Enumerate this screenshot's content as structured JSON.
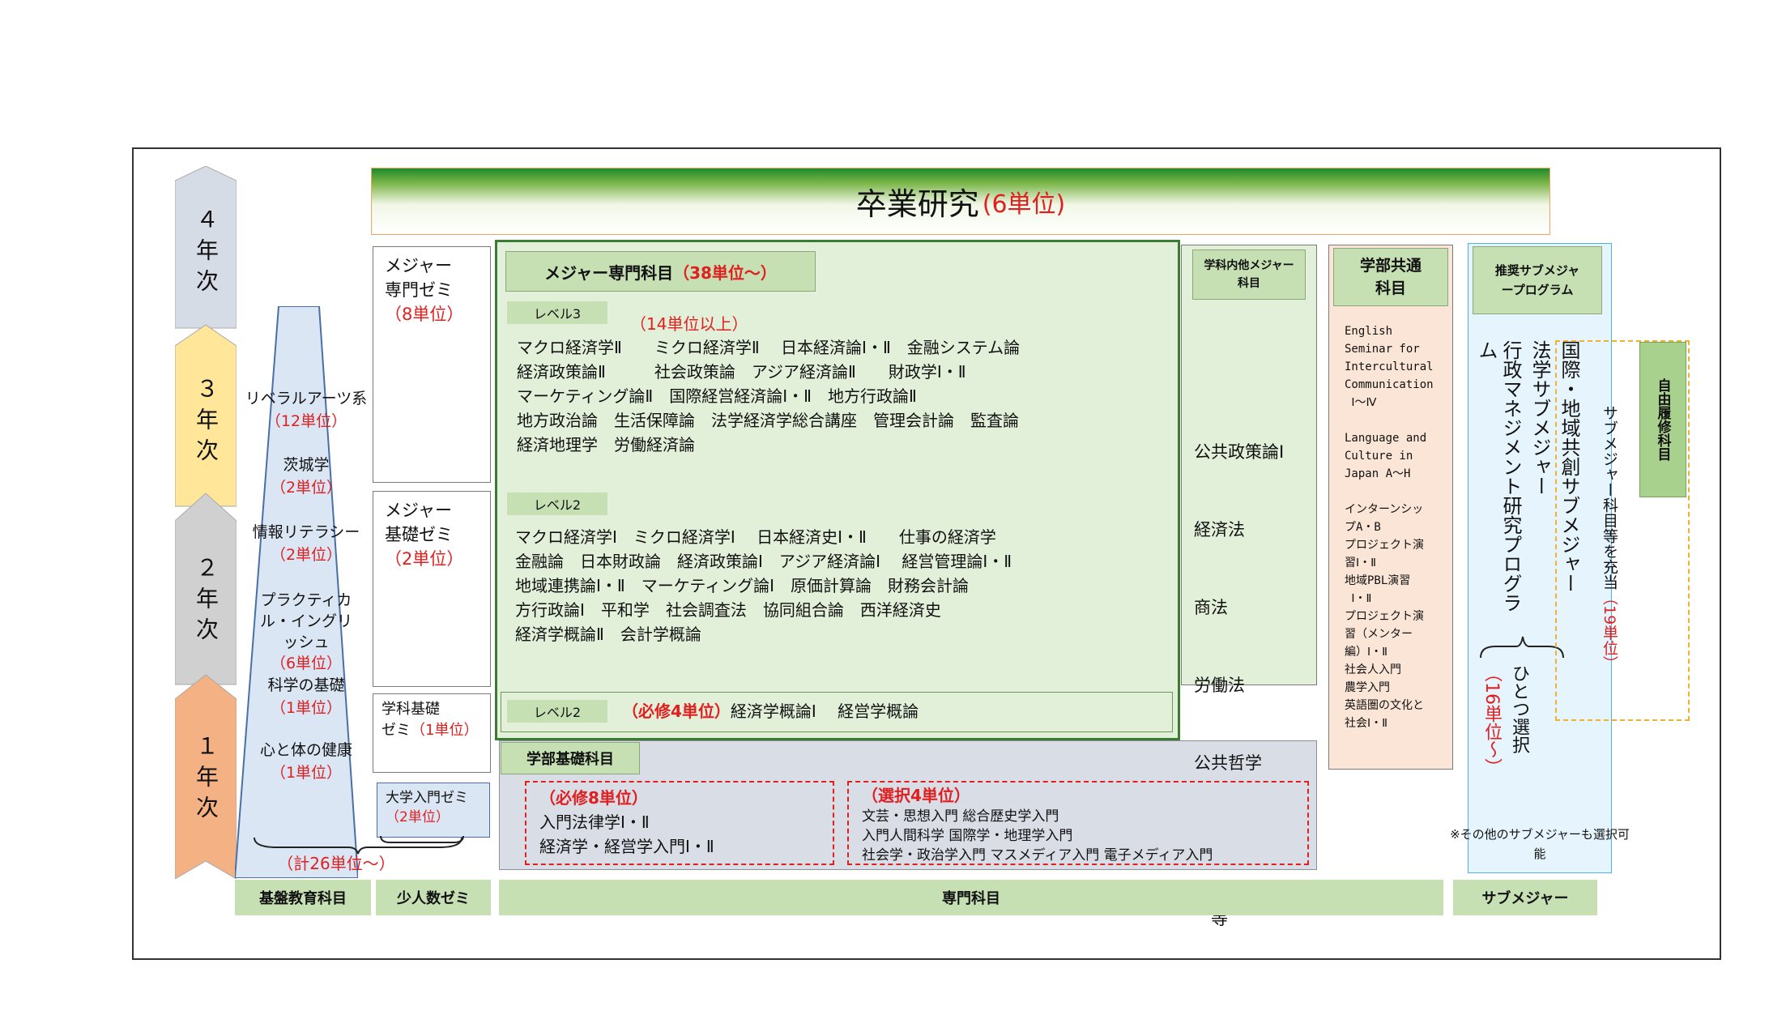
{
  "years": [
    {
      "label": "４年次",
      "color": "#d6dce5"
    },
    {
      "label": "３年次",
      "color": "#ffe699"
    },
    {
      "label": "２年次",
      "color": "#d0d0d0"
    },
    {
      "label": "１年次",
      "color": "#f4b183"
    }
  ],
  "graduation": {
    "title": "卒業研究",
    "units": "(6単位)"
  },
  "liberal": {
    "items": [
      {
        "label": "リベラルアーツ系",
        "units": "（12単位）"
      },
      {
        "label": "茨城学",
        "units": "（2単位）"
      },
      {
        "label": "情報リテラシー",
        "units": "（2単位）"
      },
      {
        "label": "プラクティカル・イングリッシュ",
        "units": "（6単位）"
      },
      {
        "label": "科学の基礎",
        "units": "（1単位）"
      },
      {
        "label": "心と体の健康",
        "units": "（1単位）"
      }
    ],
    "total": "（計26単位～）"
  },
  "seminars": {
    "major_seminar": {
      "title": "メジャー専門ゼミ",
      "units": "（8単位）"
    },
    "major_basic": {
      "title": "メジャー基礎ゼミ",
      "units": "（2単位）"
    },
    "dept_basic": {
      "title1": "学科基礎",
      "title2": "ゼミ",
      "units": "（1単位）"
    },
    "intro": {
      "title": "大学入門ゼミ",
      "units": "（2単位）"
    }
  },
  "major": {
    "title": "メジャー専門科目",
    "units": "（38単位～）",
    "level3": {
      "label": "レベル3",
      "units": "（14単位以上）",
      "lines": [
        "マクロ経済学Ⅱ　　ミクロ経済学Ⅱ　 日本経済論Ⅰ・Ⅱ　金融システム論",
        "経済政策論Ⅱ　　　社会政策論　アジア経済論Ⅱ　　財政学Ⅰ・Ⅱ",
        "マーケティング論Ⅱ　国際経営経済論Ⅰ・Ⅱ　地方行政論Ⅱ",
        "地方政治論　生活保障論　法学経済学総合講座　管理会計論　監査論",
        "経済地理学　労働経済論"
      ]
    },
    "level2": {
      "label": "レベル2",
      "lines": [
        "マクロ経済学Ⅰ　ミクロ経済学Ⅰ　 日本経済史Ⅰ・Ⅱ　　仕事の経済学",
        "金融論　日本財政論　経済政策論Ⅰ　アジア経済論Ⅰ　 経営管理論Ⅰ・Ⅱ",
        "地域連携論Ⅰ・Ⅱ　マーケティング論Ⅰ　原価計算論　財務会計論",
        "方行政論Ⅰ　平和学　社会調査法　協同組合論　西洋経済史",
        "経済学概論Ⅱ　会計学概論"
      ]
    },
    "level2_required": {
      "label": "レベル2",
      "required": "（必修4単位）",
      "courses": "経済学概論Ⅰ　 経営学概論"
    }
  },
  "faculty_basic": {
    "title": "学部基礎科目",
    "required": {
      "title": "（必修8単位）",
      "lines": [
        "入門法律学Ⅰ・Ⅱ",
        "経済学・経営学入門Ⅰ・Ⅱ"
      ]
    },
    "elective": {
      "title": "（選択4単位）",
      "lines": [
        "文芸・思想入門 総合歴史学入門",
        "入門人間科学 国際学・地理学入門",
        "社会学・政治学入門 マスメディア入門 電子メディア入門"
      ]
    }
  },
  "dept_other": {
    "title": "学科内他メジャー科目",
    "lines": [
      "公共政策論Ⅰ",
      "経済法",
      "商法",
      "労働法",
      "公共哲学",
      "",
      "　等"
    ]
  },
  "faculty_common": {
    "title": "学部共通科目",
    "lines": [
      "English",
      "Seminar for",
      "Intercultural",
      "Communication",
      " Ⅰ～Ⅳ",
      "",
      "Language and",
      "Culture in",
      "Japan A～H",
      "",
      "インターンシッ",
      "プA・B",
      "プロジェクト演",
      "習Ⅰ・Ⅱ",
      "地域PBL演習",
      " Ⅰ・Ⅱ",
      "プロジェクト演",
      "習（メンター",
      "編）Ⅰ・Ⅱ",
      "社会人入門",
      "農学入門",
      "英語圏の文化と",
      "社会Ⅰ・Ⅱ"
    ]
  },
  "submajor": {
    "title": "推奨サブメジャープログラム",
    "programs": [
      "国際・地域共創サブメジャー",
      "法学サブメジャー",
      "行政マネジメント研究プログラム"
    ],
    "choose": "ひとつ選択",
    "units": "（16単位～）",
    "note": "※その他のサブメジャーも選択可能"
  },
  "free": {
    "title": "自由履修科目",
    "text": "サブメジャー科目等を充当",
    "units": "（19単位）"
  },
  "bottom": {
    "basic": "基盤教育科目",
    "small": "少人数ゼミ",
    "special": "専門科目",
    "submajor": "サブメジャー"
  }
}
